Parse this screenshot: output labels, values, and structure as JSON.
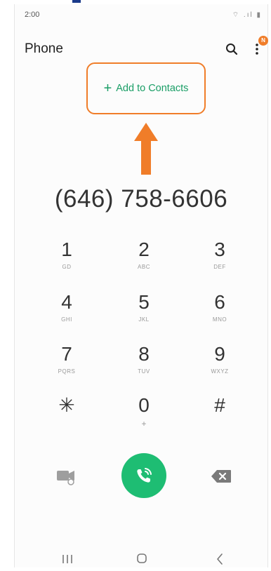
{
  "status_bar": {
    "time": "2:00",
    "icons": "⌔ .ıl ▮"
  },
  "app_bar": {
    "title": "Phone",
    "search_icon": "search-icon",
    "more_icon": "more-vertical-icon",
    "notification_badge": "N",
    "badge_color": "#f07d29"
  },
  "add_to_contacts": {
    "plus": "+",
    "label": "Add to Contacts",
    "highlight_color": "#f07d29",
    "text_color": "#1a9e66"
  },
  "dialed_number": "(646) 758-6606",
  "keypad": [
    {
      "digit": "1",
      "letters": "GD"
    },
    {
      "digit": "2",
      "letters": "ABC"
    },
    {
      "digit": "3",
      "letters": "DEF"
    },
    {
      "digit": "4",
      "letters": "GHI"
    },
    {
      "digit": "5",
      "letters": "JKL"
    },
    {
      "digit": "6",
      "letters": "MNO"
    },
    {
      "digit": "7",
      "letters": "PQRS"
    },
    {
      "digit": "8",
      "letters": "TUV"
    },
    {
      "digit": "9",
      "letters": "WXYZ"
    },
    {
      "digit": "✳",
      "letters": ""
    },
    {
      "digit": "0",
      "letters": "+"
    },
    {
      "digit": "#",
      "letters": ""
    }
  ],
  "actions": {
    "video_call_icon": "video-call-icon",
    "call_icon": "wifi-call-icon",
    "call_color": "#1ebd73",
    "backspace_icon": "backspace-icon"
  },
  "nav_bar": {
    "recent_icon": "recent-apps-icon",
    "home_icon": "home-icon",
    "back_icon": "back-icon"
  }
}
